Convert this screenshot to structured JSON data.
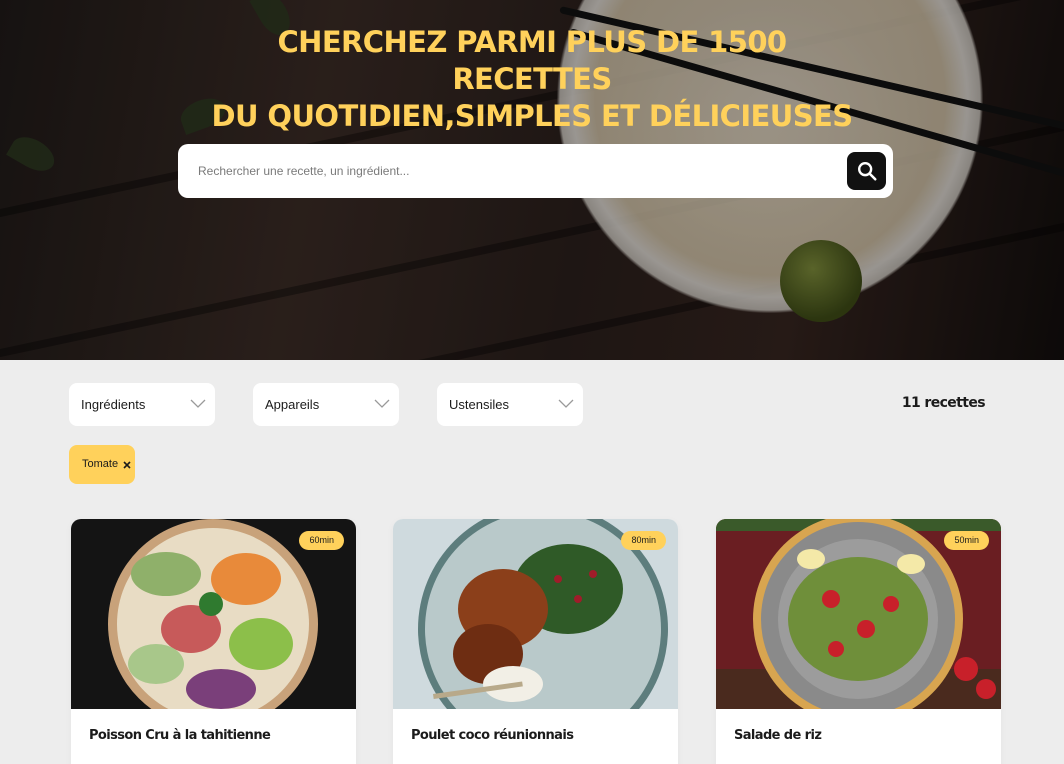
{
  "hero": {
    "title_line1": "CHERCHEZ PARMI PLUS DE 1500 RECETTES",
    "title_line2": "DU QUOTIDIEN,SIMPLES ET DÉLICIEUSES"
  },
  "search": {
    "placeholder": "Rechercher une recette, un ingrédient...",
    "value": "",
    "icon": "search-icon"
  },
  "filters": [
    {
      "label": "Ingrédients",
      "icon": "chevron-down-icon"
    },
    {
      "label": "Appareils",
      "icon": "chevron-down-icon"
    },
    {
      "label": "Ustensiles",
      "icon": "chevron-down-icon"
    }
  ],
  "recipe_count": "11 recettes",
  "active_tags": [
    {
      "label": "Tomate",
      "icon": "close-icon"
    }
  ],
  "recipes": [
    {
      "title": "Poisson Cru à la tahitienne",
      "time": "60min"
    },
    {
      "title": "Poulet coco réunionnais",
      "time": "80min"
    },
    {
      "title": "Salade de riz",
      "time": "50min"
    }
  ],
  "colors": {
    "accent": "#ffd15b",
    "dark": "#1b1b1b",
    "background": "#ededed"
  }
}
